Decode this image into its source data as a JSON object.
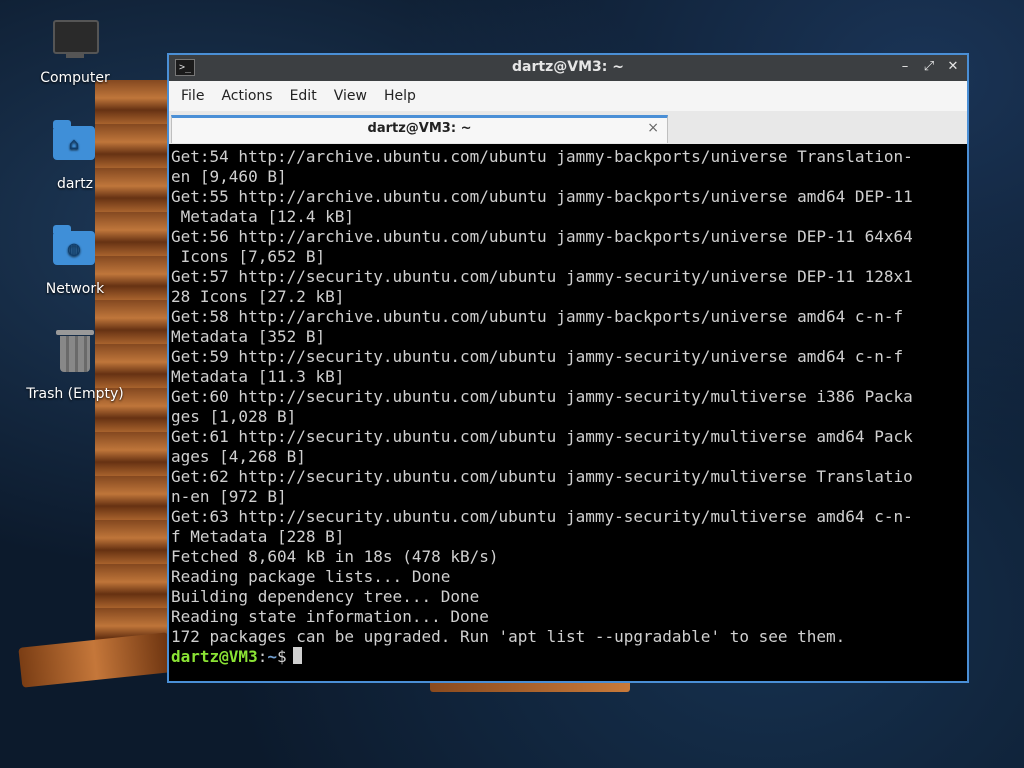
{
  "desktop": {
    "icons": [
      {
        "label": "Computer",
        "icon": "computer-icon"
      },
      {
        "label": "dartz",
        "icon": "home-folder-icon"
      },
      {
        "label": "Network",
        "icon": "network-folder-icon"
      },
      {
        "label": "Trash (Empty)",
        "icon": "trash-icon"
      }
    ]
  },
  "window": {
    "title": "dartz@VM3: ~",
    "controls": {
      "minimize": "–",
      "maximize": "⤢",
      "close": "✕"
    },
    "menu": [
      "File",
      "Actions",
      "Edit",
      "View",
      "Help"
    ],
    "tab": {
      "label": "dartz@VM3: ~",
      "close": "×"
    }
  },
  "terminal": {
    "lines": [
      "Get:54 http://archive.ubuntu.com/ubuntu jammy-backports/universe Translation-",
      "en [9,460 B]",
      "Get:55 http://archive.ubuntu.com/ubuntu jammy-backports/universe amd64 DEP-11",
      " Metadata [12.4 kB]",
      "Get:56 http://archive.ubuntu.com/ubuntu jammy-backports/universe DEP-11 64x64",
      " Icons [7,652 B]",
      "Get:57 http://security.ubuntu.com/ubuntu jammy-security/universe DEP-11 128x1",
      "28 Icons [27.2 kB]",
      "Get:58 http://archive.ubuntu.com/ubuntu jammy-backports/universe amd64 c-n-f",
      "Metadata [352 B]",
      "Get:59 http://security.ubuntu.com/ubuntu jammy-security/universe amd64 c-n-f",
      "Metadata [11.3 kB]",
      "Get:60 http://security.ubuntu.com/ubuntu jammy-security/multiverse i386 Packa",
      "ges [1,028 B]",
      "Get:61 http://security.ubuntu.com/ubuntu jammy-security/multiverse amd64 Pack",
      "ages [4,268 B]",
      "Get:62 http://security.ubuntu.com/ubuntu jammy-security/multiverse Translatio",
      "n-en [972 B]",
      "Get:63 http://security.ubuntu.com/ubuntu jammy-security/multiverse amd64 c-n-",
      "f Metadata [228 B]",
      "Fetched 8,604 kB in 18s (478 kB/s)",
      "Reading package lists... Done",
      "Building dependency tree... Done",
      "Reading state information... Done",
      "172 packages can be upgraded. Run 'apt list --upgradable' to see them."
    ],
    "prompt": {
      "user_host": "dartz@VM3",
      "colon": ":",
      "path": "~",
      "symbol": "$"
    }
  }
}
